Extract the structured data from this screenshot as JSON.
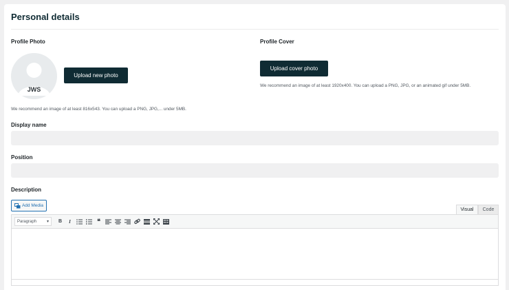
{
  "section": {
    "title": "Personal details"
  },
  "profile_photo": {
    "label": "Profile Photo",
    "initials": "JWS",
    "upload_button": "Upload new photo",
    "hint": "We recommend an image of at least 816x543. You can upload a PNG, JPG,... under 5MB."
  },
  "profile_cover": {
    "label": "Profile Cover",
    "upload_button": "Upload cover photo",
    "hint": "We recommend an image of at least 1920x400. You can upload a PNG, JPG, or an animated gif under 5MB."
  },
  "fields": {
    "display_name": {
      "label": "Display name",
      "value": ""
    },
    "position": {
      "label": "Position",
      "value": ""
    },
    "description": {
      "label": "Description"
    }
  },
  "editor": {
    "add_media": "Add Media",
    "tabs": {
      "visual": "Visual",
      "code": "Code"
    },
    "format_select": "Paragraph",
    "toolbar_icons": [
      "bold-icon",
      "italic-icon",
      "bullet-list-icon",
      "numbered-list-icon",
      "blockquote-icon",
      "align-left-icon",
      "align-center-icon",
      "align-right-icon",
      "link-icon",
      "read-more-icon",
      "fullscreen-icon",
      "toolbar-toggle-icon"
    ],
    "bold": "B",
    "italic": "I",
    "quote": "❝"
  },
  "colors": {
    "dark_button": "#0f2b33",
    "link_blue": "#2271b1",
    "input_bg": "#f0f0f1"
  }
}
